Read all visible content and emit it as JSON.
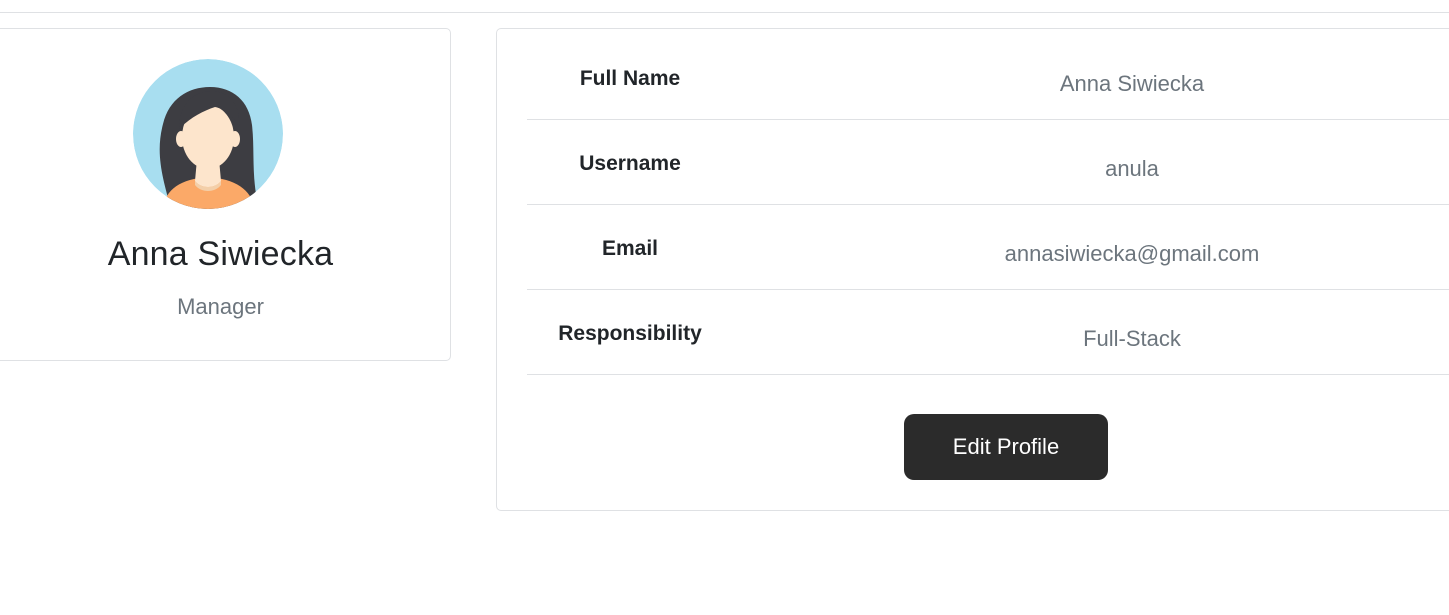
{
  "profile": {
    "name": "Anna Siwiecka",
    "role": "Manager",
    "avatar_icon": "female-avatar-icon"
  },
  "details": {
    "rows": [
      {
        "label": "Full Name",
        "value": "Anna Siwiecka"
      },
      {
        "label": "Username",
        "value": "anula"
      },
      {
        "label": "Email",
        "value": "annasiwiecka@gmail.com"
      },
      {
        "label": "Responsibility",
        "value": "Full-Stack"
      }
    ],
    "edit_button_label": "Edit Profile"
  },
  "colors": {
    "avatar_bg": "#a8def0",
    "hair": "#3d3d42",
    "skin": "#fde5cc",
    "shirt": "#fba968",
    "button_bg": "#2b2b2b",
    "muted_text": "#6c757d",
    "border": "#dfe1e4"
  }
}
